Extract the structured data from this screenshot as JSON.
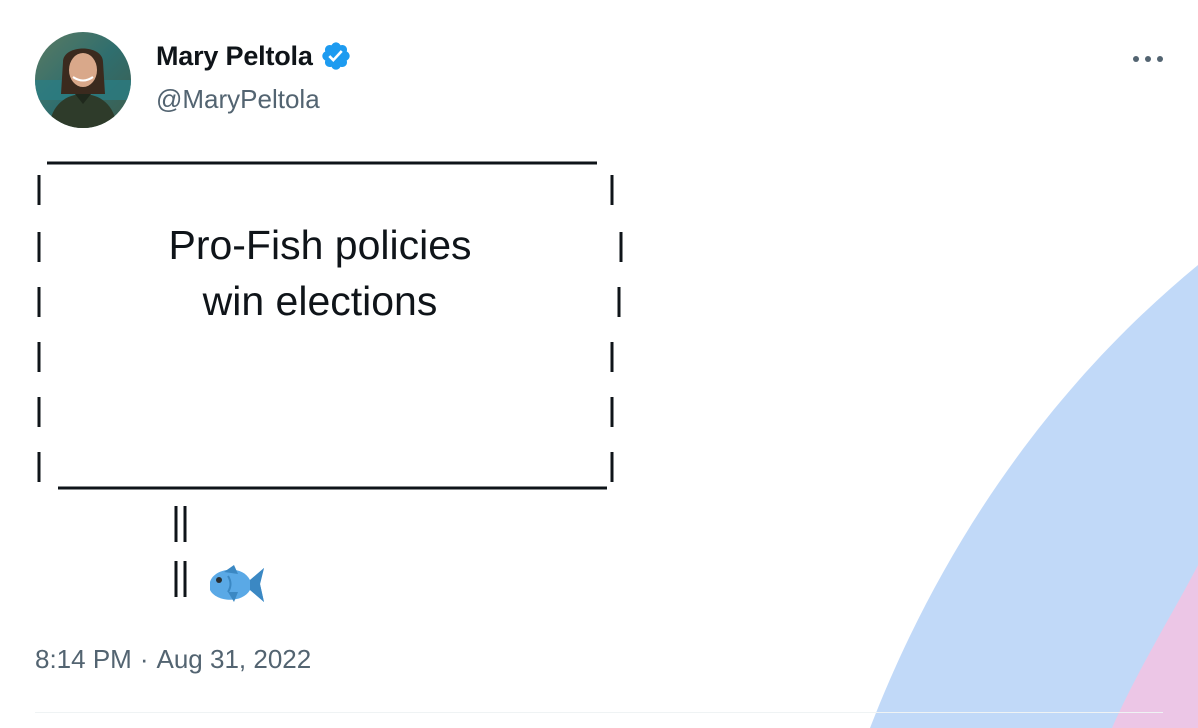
{
  "author": {
    "display_name": "Mary Peltola",
    "handle": "@MaryPeltola",
    "verified": true,
    "avatar_icon": "profile-photo"
  },
  "tweet": {
    "sign_lines": [
      "Pro-Fish policies",
      "win elections"
    ],
    "emoji": "fish-icon",
    "time": "8:14 PM",
    "separator": "·",
    "date": "Aug 31, 2022"
  },
  "icons": {
    "more": "more-horizontal-icon",
    "verified": "verified-badge-icon"
  },
  "colors": {
    "verified_blue": "#1d9bf0",
    "text_primary": "#0f1419",
    "text_secondary": "#536471",
    "arc_blue": "#c1d9f8",
    "arc_pink": "#ecc6e6"
  }
}
